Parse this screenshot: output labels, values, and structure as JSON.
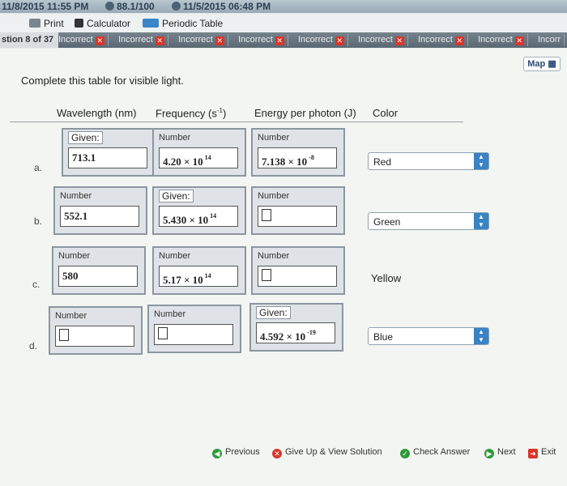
{
  "status_bar": {
    "left_datetime": "11/8/2015 11:55 PM",
    "score": "88.1/100",
    "right_datetime": "11/5/2015 06:48 PM"
  },
  "toolbar": {
    "print_label": "Print",
    "calculator_label": "Calculator",
    "periodic_table_label": "Periodic Table"
  },
  "question_tabs": {
    "count": "stion 8 of 37",
    "items": [
      "Incorrect",
      "Incorrect",
      "Incorrect",
      "Incorrect",
      "Incorrect",
      "Incorrect",
      "Incorrect",
      "Incorrect",
      "Incorr"
    ]
  },
  "map_label": "Map",
  "instruction": "Complete this table for visible light.",
  "headers": {
    "wavelength": "Wavelength (nm)",
    "frequency": "Frequency (s",
    "frequency_exp": "-1",
    "frequency_close": ")",
    "energy": "Energy per photon (J)",
    "color": "Color"
  },
  "rows": [
    {
      "label": "a.",
      "wavelength": {
        "tag": "Given:",
        "value": "713.1"
      },
      "frequency": {
        "tag": "Number",
        "value": "4.20 × 10",
        "exp": "14"
      },
      "energy": {
        "tag": "Number",
        "value": "7.138 × 10",
        "exp": "-8"
      },
      "color": "Red"
    },
    {
      "label": "b.",
      "wavelength": {
        "tag": "Number",
        "value": "552.1"
      },
      "frequency": {
        "tag": "Given:",
        "value": "5.430 × 10",
        "exp": "14"
      },
      "energy": {
        "tag": "Number",
        "value": ""
      },
      "color": "Green"
    },
    {
      "label": "c.",
      "wavelength": {
        "tag": "Number",
        "value": "580"
      },
      "frequency": {
        "tag": "Number",
        "value": "5.17 × 10",
        "exp": "14"
      },
      "energy": {
        "tag": "Number",
        "value": ""
      },
      "color": "Yellow"
    },
    {
      "label": "d.",
      "wavelength": {
        "tag": "Number",
        "value": ""
      },
      "frequency": {
        "tag": "Number",
        "value": ""
      },
      "energy": {
        "tag": "Given:",
        "value": "4.592 × 10",
        "exp": "-19"
      },
      "color": "Blue"
    }
  ],
  "footer": {
    "previous": "Previous",
    "give_up": "Give Up & View Solution",
    "check": "Check Answer",
    "next": "Next",
    "exit": "Exit"
  }
}
